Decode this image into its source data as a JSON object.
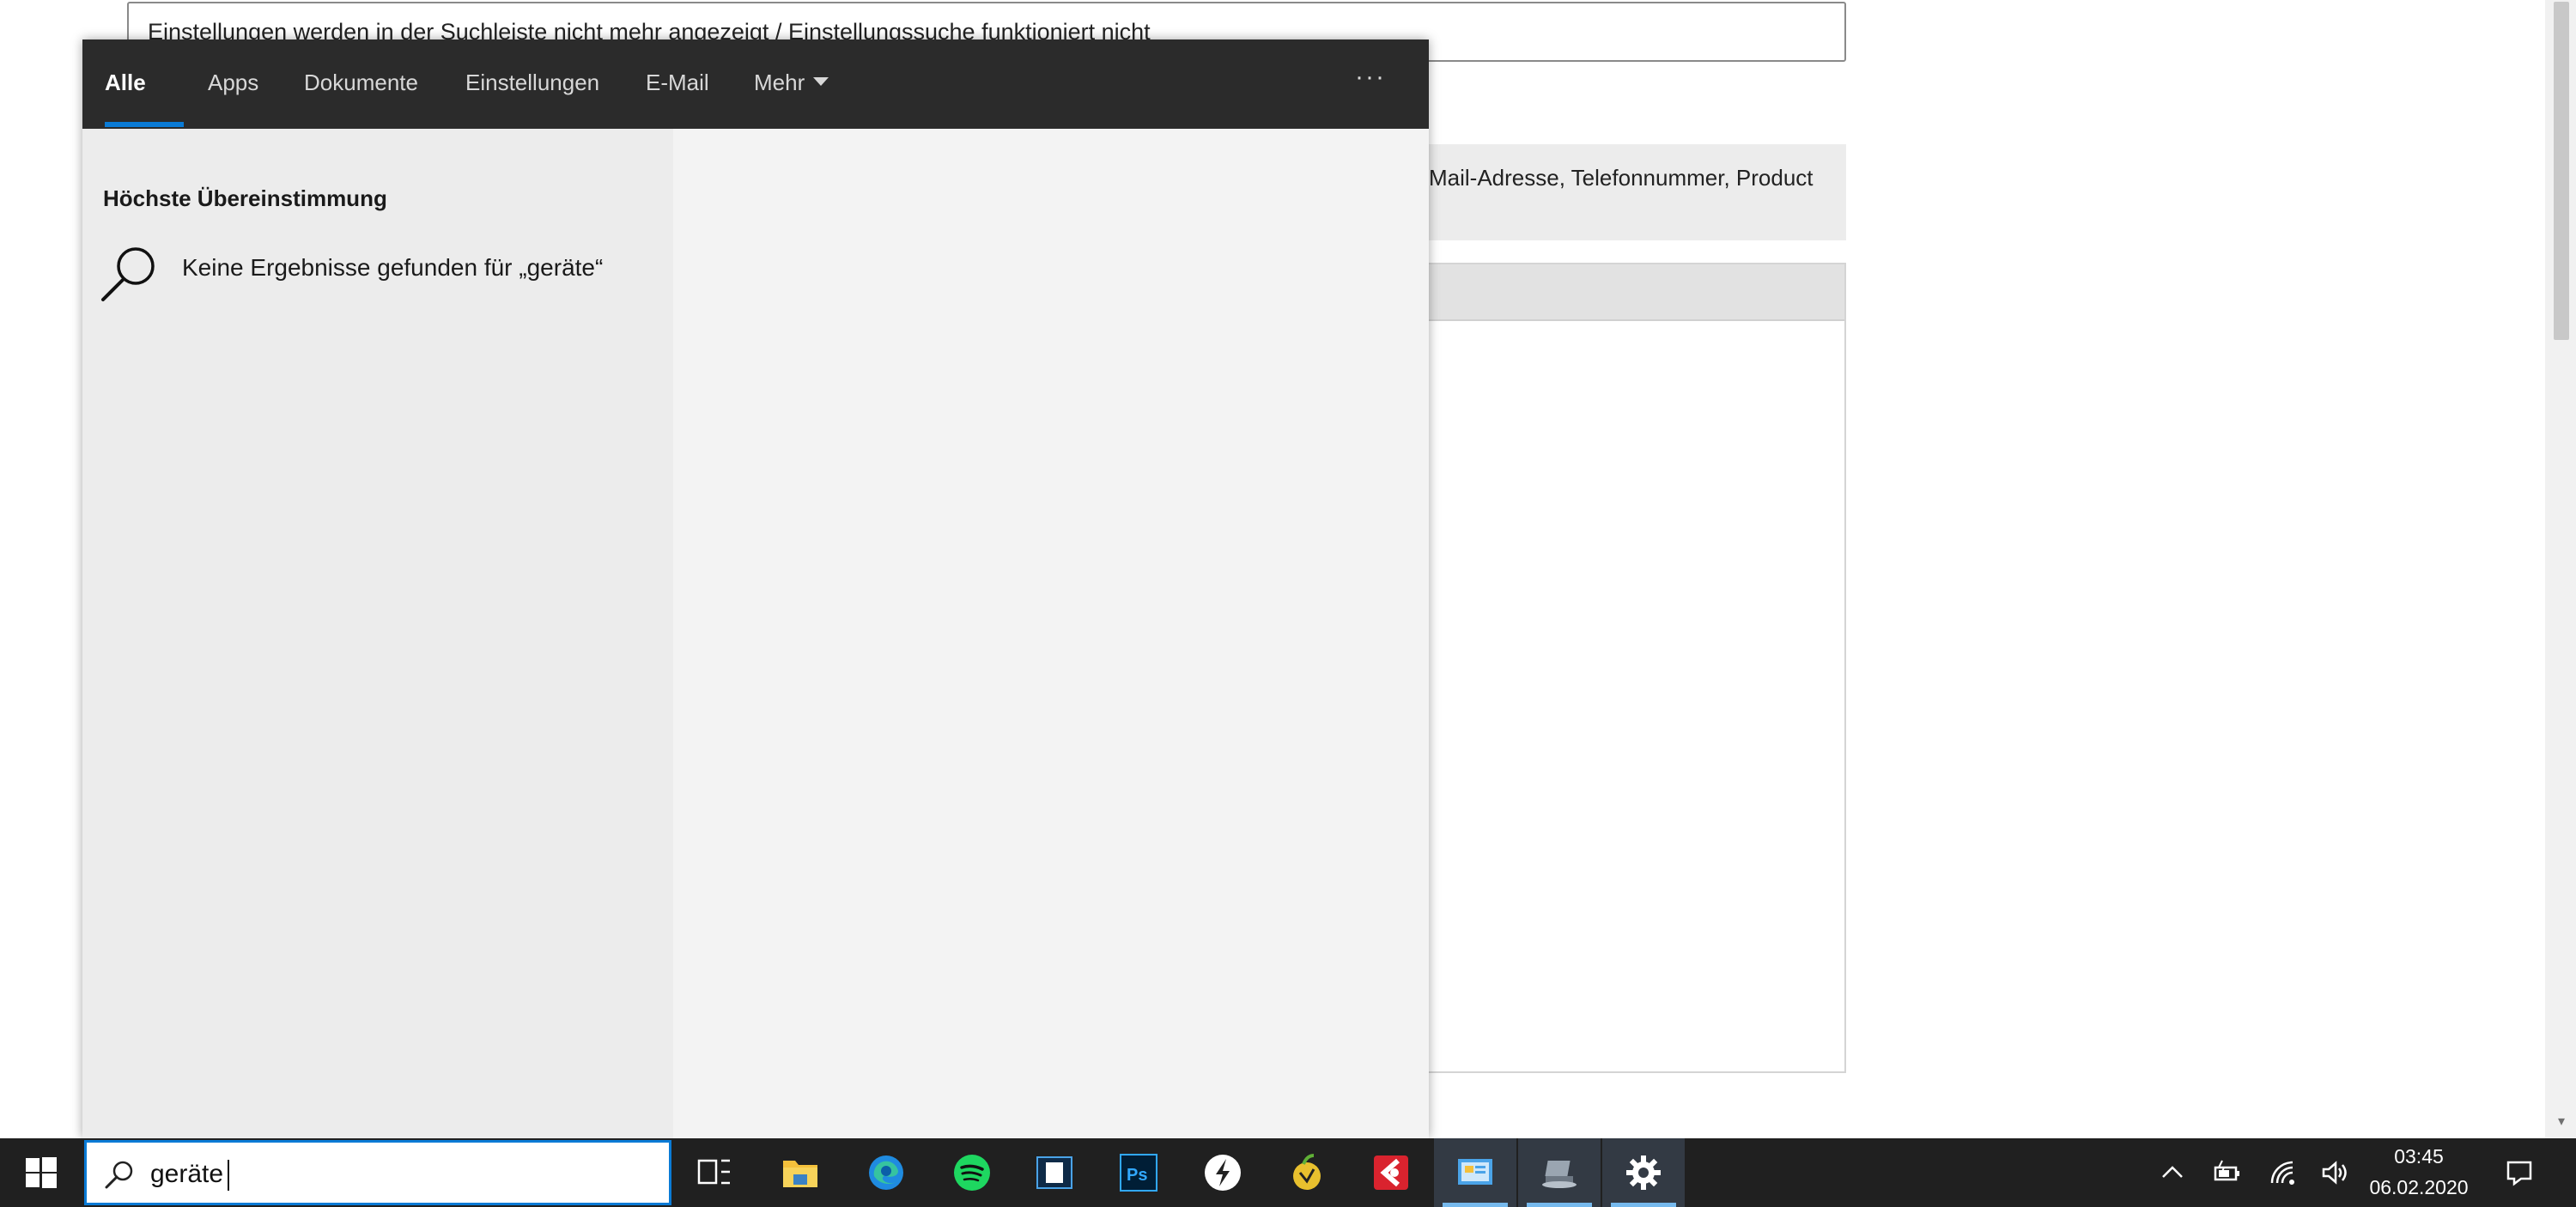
{
  "background_page": {
    "title_text": "Einstellungen werden in der Suchleiste nicht mehr angezeigt / Einstellungssuche funktioniert nicht",
    "info_text": "Mail-Adresse, Telefonnummer, Product"
  },
  "search_flyout": {
    "tabs": [
      {
        "label": "Alle",
        "active": true
      },
      {
        "label": "Apps"
      },
      {
        "label": "Dokumente"
      },
      {
        "label": "Einstellungen"
      },
      {
        "label": "E-Mail"
      },
      {
        "label": "Mehr"
      }
    ],
    "more_options": "···",
    "section_title": "Höchste Übereinstimmung",
    "no_results_text": "Keine Ergebnisse gefunden für „geräte“"
  },
  "taskbar": {
    "search_value": "geräte",
    "pinned_apps": [
      {
        "name": "task-view",
        "icon": "task-view-icon"
      },
      {
        "name": "file-explorer",
        "icon": "folder-icon"
      },
      {
        "name": "edge",
        "icon": "edge-icon"
      },
      {
        "name": "spotify",
        "icon": "spotify-icon"
      },
      {
        "name": "video-editor",
        "icon": "film-icon"
      },
      {
        "name": "photoshop",
        "icon": "photoshop-icon",
        "label": "Ps"
      },
      {
        "name": "app-bolt",
        "icon": "bolt-icon"
      },
      {
        "name": "app-fruit",
        "icon": "fruit-icon"
      },
      {
        "name": "app-red",
        "icon": "red-app-icon"
      },
      {
        "name": "control-panel",
        "icon": "control-panel-icon",
        "running": true
      },
      {
        "name": "network-app",
        "icon": "network-icon",
        "running": true
      },
      {
        "name": "settings",
        "icon": "gear-icon",
        "running": true
      }
    ],
    "clock": {
      "time": "03:45",
      "date": "06.02.2020"
    }
  },
  "colors": {
    "accent": "#0a7bd6",
    "taskbar": "#202020",
    "tabbar": "#2b2b2b"
  }
}
